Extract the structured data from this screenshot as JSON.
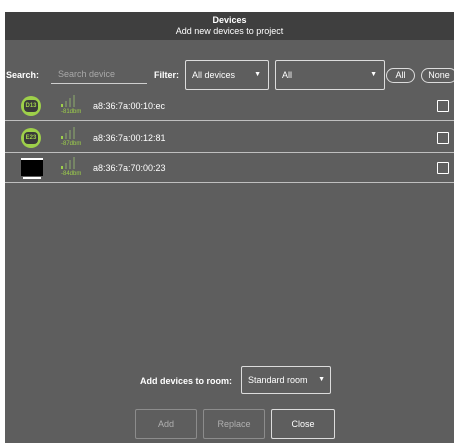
{
  "header": {
    "title": "Devices",
    "subtitle": "Add new devices to project"
  },
  "filters": {
    "search_label": "Search:",
    "search_placeholder": "Search device",
    "search_value": "",
    "filter_label": "Filter:",
    "filter_type": "All devices",
    "filter_second": "All",
    "all_label": "All",
    "none_label": "None"
  },
  "devices": [
    {
      "icon": "d13-device-icon",
      "icon_text": "D13",
      "mac": "a8:36:7a:00:10:ec",
      "rssi": "-81dbm",
      "signal_level": 1,
      "checked": false
    },
    {
      "icon": "e23-device-icon",
      "icon_text": "E23",
      "mac": "a8:36:7a:00:12:81",
      "rssi": "-87dbm",
      "signal_level": 1,
      "checked": false
    },
    {
      "icon": "tv-icon",
      "icon_text": "",
      "mac": "a8:36:7a:70:00:23",
      "rssi": "-84dbm",
      "signal_level": 1,
      "checked": false
    }
  ],
  "room": {
    "label": "Add devices to room:",
    "value": "Standard room"
  },
  "buttons": {
    "add": "Add",
    "replace": "Replace",
    "close": "Close"
  },
  "colors": {
    "background": "#5e5e5e",
    "header": "#3f3f3f",
    "accent": "#9ed04a"
  }
}
